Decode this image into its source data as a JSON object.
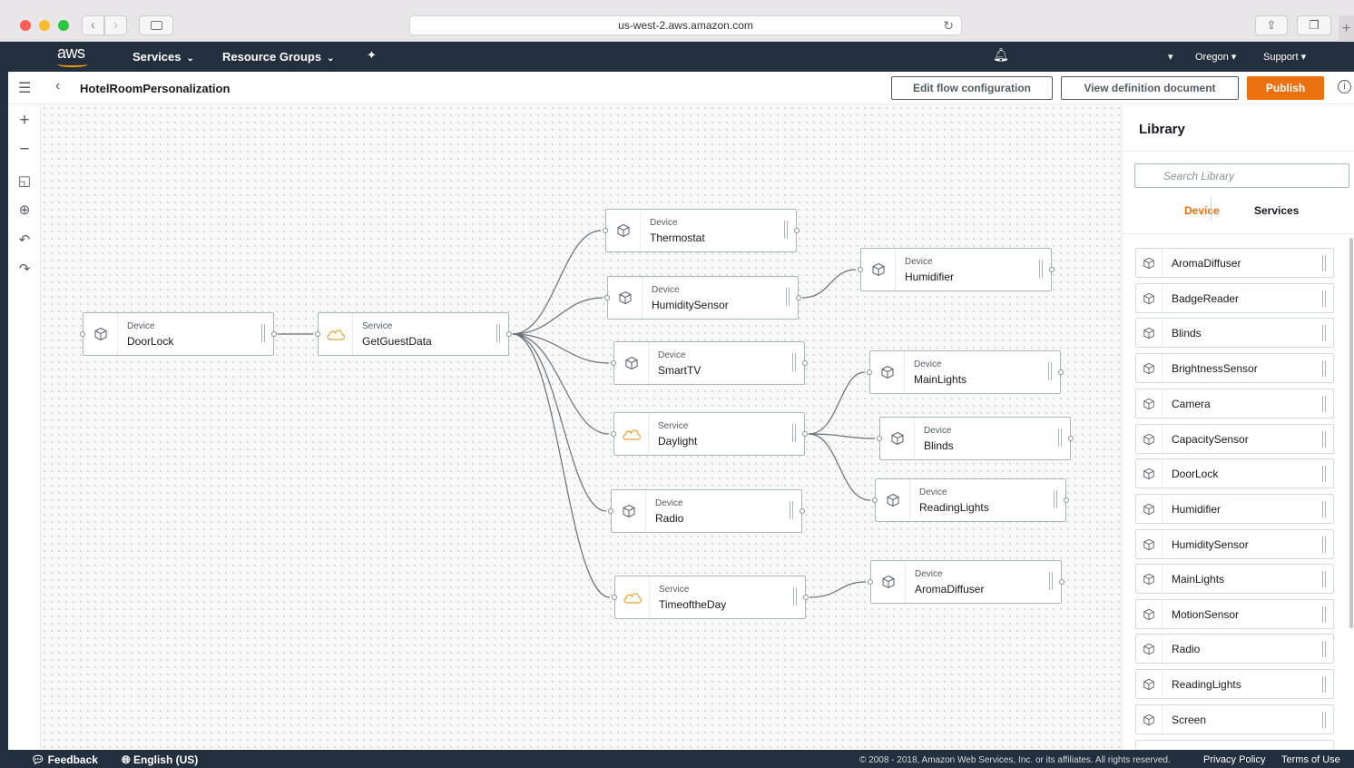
{
  "browser": {
    "url": "us-west-2.aws.amazon.com"
  },
  "aws_nav": {
    "logo": "aws",
    "services": "Services",
    "resource_groups": "Resource Groups",
    "region": "Oregon",
    "support": "Support"
  },
  "flow": {
    "title": "HotelRoomPersonalization",
    "edit_button": "Edit flow configuration",
    "view_button": "View definition document",
    "publish_button": "Publish"
  },
  "nodes": [
    {
      "id": "doorlock",
      "type": "Device",
      "name": "DoorLock",
      "icon": "cube-icon"
    },
    {
      "id": "getguestdata",
      "type": "Service",
      "name": "GetGuestData",
      "icon": "cloud-icon"
    },
    {
      "id": "thermostat",
      "type": "Device",
      "name": "Thermostat",
      "icon": "cube-icon"
    },
    {
      "id": "humiditysensor",
      "type": "Device",
      "name": "HumiditySensor",
      "icon": "cube-icon"
    },
    {
      "id": "humidifier",
      "type": "Device",
      "name": "Humidifier",
      "icon": "cube-icon"
    },
    {
      "id": "smarttv",
      "type": "Device",
      "name": "SmartTV",
      "icon": "cube-icon"
    },
    {
      "id": "mainlights",
      "type": "Device",
      "name": "MainLights",
      "icon": "cube-icon"
    },
    {
      "id": "daylight",
      "type": "Service",
      "name": "Daylight",
      "icon": "cloud-icon"
    },
    {
      "id": "blinds",
      "type": "Device",
      "name": "Blinds",
      "icon": "cube-icon"
    },
    {
      "id": "readinglights",
      "type": "Device",
      "name": "ReadingLights",
      "icon": "cube-icon"
    },
    {
      "id": "radio",
      "type": "Device",
      "name": "Radio",
      "icon": "cube-icon"
    },
    {
      "id": "timeoftheday",
      "type": "Service",
      "name": "TimeoftheDay",
      "icon": "cloud-icon"
    },
    {
      "id": "aromadiffuser",
      "type": "Device",
      "name": "AromaDiffuser",
      "icon": "cube-icon"
    }
  ],
  "library": {
    "title": "Library",
    "search_placeholder": "Search Library",
    "tabs": [
      {
        "label": "Device",
        "active": true
      },
      {
        "label": "Services",
        "active": false
      }
    ],
    "items": [
      "AromaDiffuser",
      "BadgeReader",
      "Blinds",
      "BrightnessSensor",
      "Camera",
      "CapacitySensor",
      "DoorLock",
      "Humidifier",
      "HumiditySensor",
      "MainLights",
      "MotionSensor",
      "Radio",
      "ReadingLights",
      "Screen"
    ]
  },
  "footer": {
    "feedback": "Feedback",
    "language": "English (US)",
    "copyright": "© 2008 - 2018, Amazon Web Services, Inc. or its affiliates. All rights reserved.",
    "privacy": "Privacy Policy",
    "terms": "Terms of Use"
  },
  "colors": {
    "aws_navy": "#232f3e",
    "publish_orange": "#ec7211",
    "active_tab": "#ec7211",
    "service_cloud": "#f0a030"
  }
}
